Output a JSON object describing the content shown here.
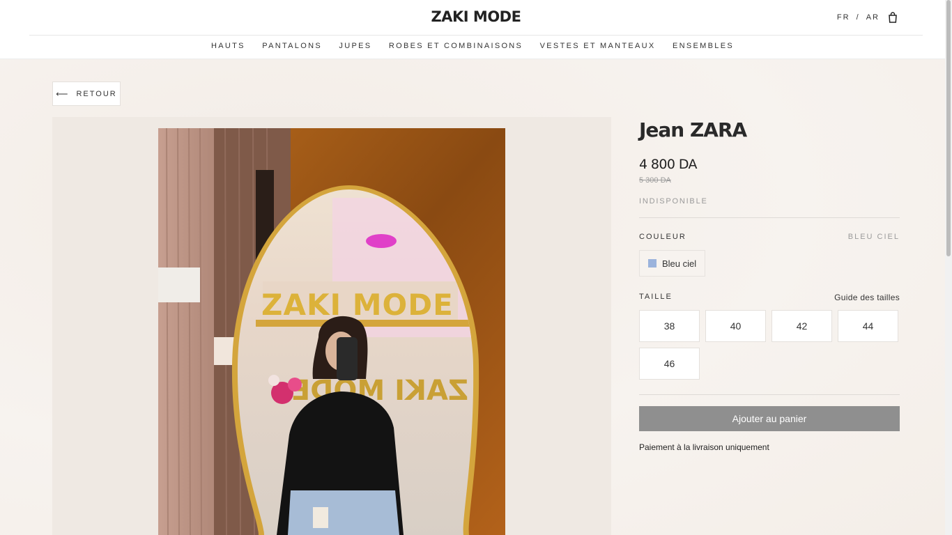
{
  "header": {
    "brand": "ZAKI MODE",
    "lang_fr": "FR",
    "lang_sep": "/",
    "lang_ar": "AR",
    "cart_icon": "shopping-bag-icon"
  },
  "nav": {
    "items": [
      {
        "label": "HAUTS"
      },
      {
        "label": "PANTALONS"
      },
      {
        "label": "JUPES"
      },
      {
        "label": "ROBES ET COMBINAISONS"
      },
      {
        "label": "VESTES ET MANTEAUX"
      },
      {
        "label": "ENSEMBLES"
      }
    ]
  },
  "back": {
    "arrow": "⟵",
    "label": "RETOUR"
  },
  "product": {
    "title": "Jean ZARA",
    "price": "4 800 DA",
    "old_price": "5 300 DA",
    "status": "INDISPONIBLE",
    "color_label": "COULEUR",
    "color_selected": "BLEU CIEL",
    "color_option": {
      "label": "Bleu ciel",
      "swatch": "#9bb3dc"
    },
    "size_label": "TAILLE",
    "size_guide": "Guide des tailles",
    "sizes": [
      "38",
      "40",
      "42",
      "44",
      "46"
    ],
    "add_to_cart": "Ajouter au panier",
    "payment_note": "Paiement à la livraison uniquement"
  },
  "photo": {
    "sign_text": "ZAKI MODE",
    "sign_text_mirrored": "ZAKI MODE"
  },
  "colors": {
    "accent_button": "#8f8f8f",
    "swatch_bleu_ciel": "#9bb3dc"
  }
}
